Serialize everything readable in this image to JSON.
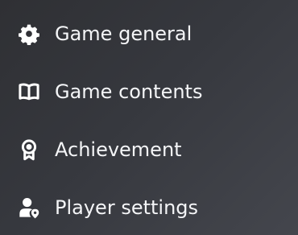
{
  "menu": {
    "items": [
      {
        "label": "Game general",
        "icon": "gear-icon"
      },
      {
        "label": "Game contents",
        "icon": "book-open-icon"
      },
      {
        "label": "Achievement",
        "icon": "award-medal-icon"
      },
      {
        "label": "Player settings",
        "icon": "user-location-icon"
      }
    ]
  },
  "colors": {
    "background": "#36383e",
    "text": "#f4f5f7",
    "icon": "#ffffff"
  }
}
